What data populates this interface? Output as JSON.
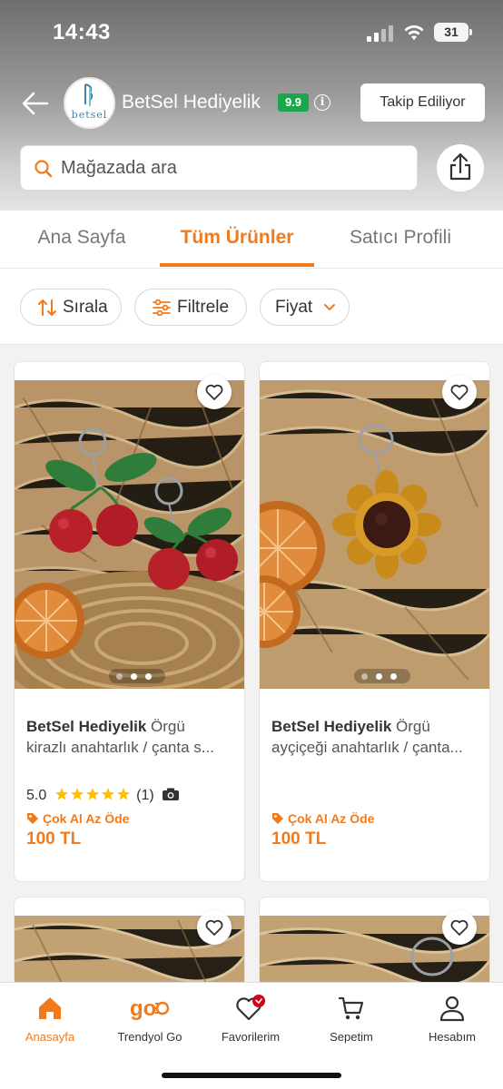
{
  "status": {
    "time": "14:43",
    "battery": "31"
  },
  "store": {
    "name": "BetSel Hediyelik",
    "rating": "9.9",
    "logo_text": "betsel",
    "follow_label": "Takip Ediliyor"
  },
  "search": {
    "placeholder": "Mağazada ara"
  },
  "tabs": [
    {
      "label": "Ana Sayfa",
      "active": false
    },
    {
      "label": "Tüm Ürünler",
      "active": true
    },
    {
      "label": "Satıcı Profili",
      "active": false
    }
  ],
  "filters": {
    "sort": "Sırala",
    "filter": "Filtrele",
    "price": "Fiyat"
  },
  "products": [
    {
      "brand": "BetSel Hediyelik",
      "title_line1": "Örgü",
      "title_line2": "kirazlı anahtarlık / çanta s...",
      "rating": "5.0",
      "stars": 5,
      "review_count": "(1)",
      "promo": "Çok Al Az Öde",
      "price": "100 TL"
    },
    {
      "brand": "BetSel Hediyelik",
      "title_line1": "Örgü",
      "title_line2": "ayçiçeği anahtarlık / çanta...",
      "promo": "Çok Al Az Öde",
      "price": "100 TL"
    }
  ],
  "nav": [
    {
      "label": "Anasayfa",
      "icon": "home-icon",
      "active": true
    },
    {
      "label": "Trendyol Go",
      "icon": "trendyol-go-icon",
      "active": false
    },
    {
      "label": "Favorilerim",
      "icon": "heart-icon",
      "active": false
    },
    {
      "label": "Sepetim",
      "icon": "cart-icon",
      "active": false
    },
    {
      "label": "Hesabım",
      "icon": "user-icon",
      "active": false
    }
  ],
  "colors": {
    "accent": "#f27a1a",
    "rating_badge": "#1aa64a"
  }
}
